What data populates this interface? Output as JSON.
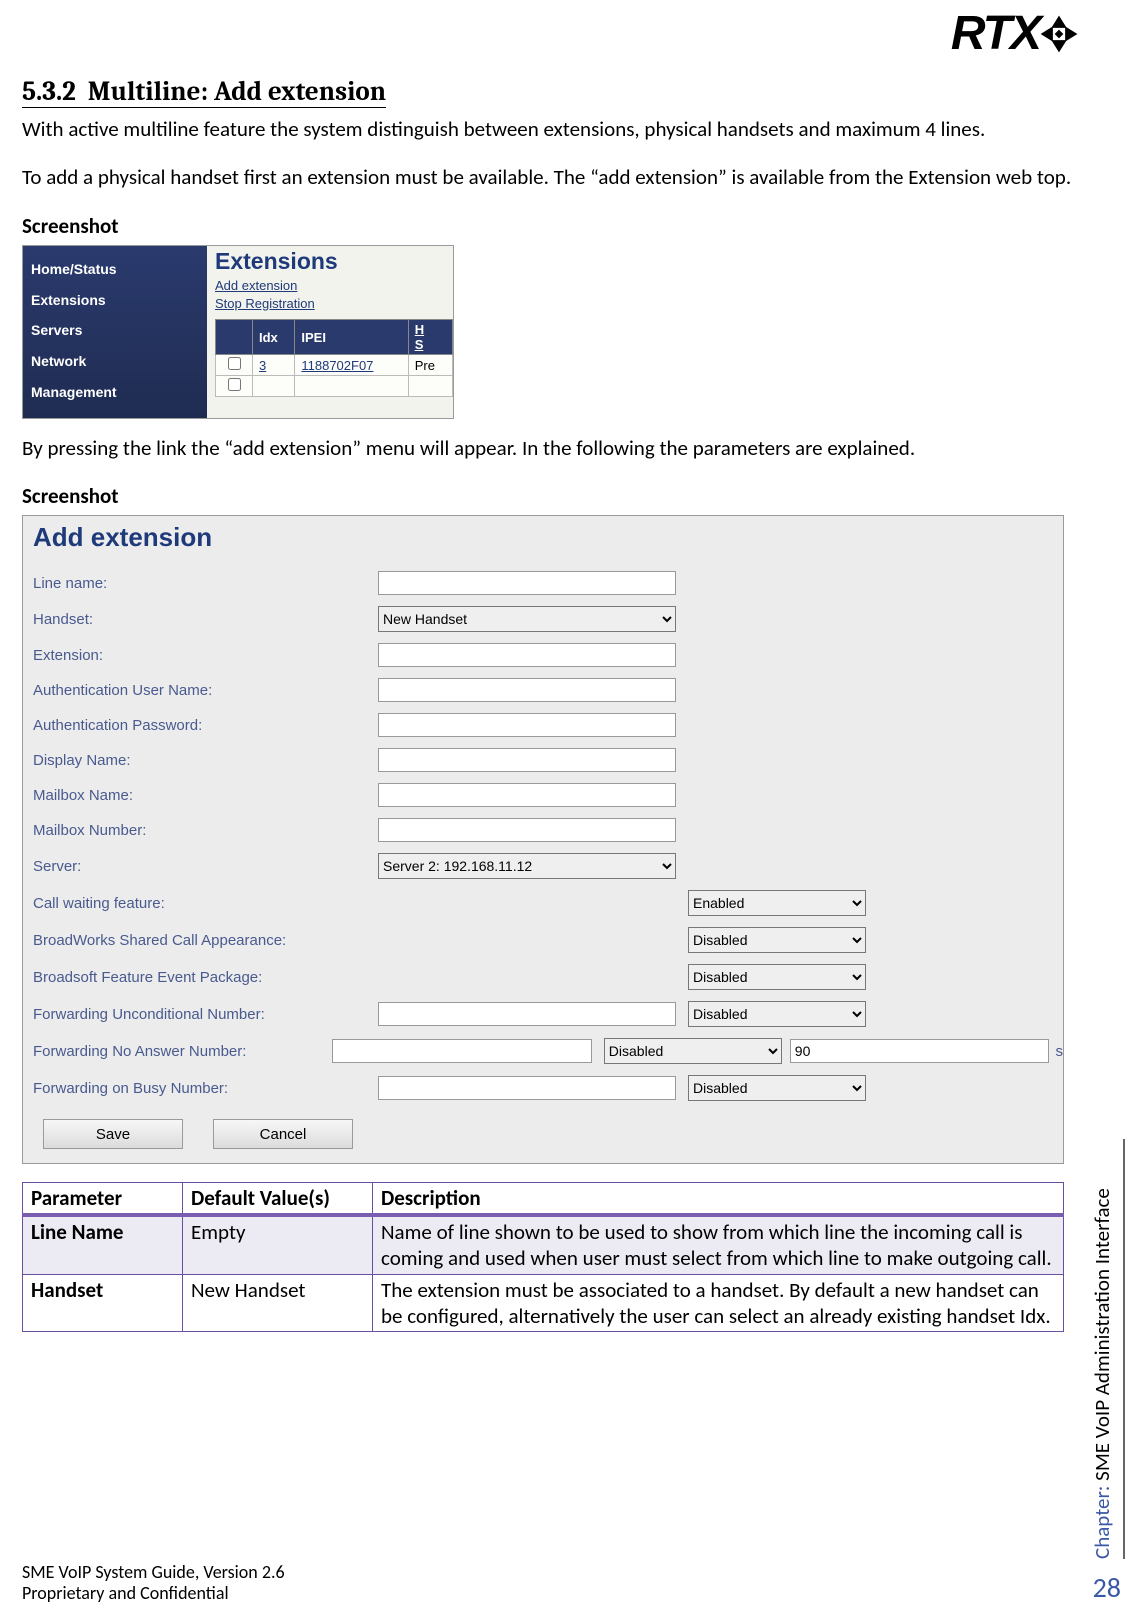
{
  "logo_text": "RTX",
  "section_number": "5.3.2",
  "section_title": "Multiline: Add extension",
  "para1": "With active multiline feature the system distinguish between extensions, physical handsets and maximum 4 lines.",
  "para2": "To add a physical handset first an extension must be available. The “add extension” is available from the Extension web top.",
  "screenshot_label": "Screenshot",
  "ss1": {
    "nav": [
      "Home/Status",
      "Extensions",
      "Servers",
      "Network",
      "Management"
    ],
    "title": "Extensions",
    "links": [
      "Add extension",
      "Stop Registration"
    ],
    "cols": [
      "",
      "Idx",
      "IPEI",
      "H\nS"
    ],
    "row": {
      "idx": "3",
      "ipei": "1188702F07",
      "state": "Pre"
    }
  },
  "para3": "By pressing the link the “add extension” menu will appear. In the following the parameters are explained.",
  "ss2": {
    "title": "Add extension",
    "labels": {
      "line_name": "Line name:",
      "handset": "Handset:",
      "extension": "Extension:",
      "auth_user": "Authentication User Name:",
      "auth_pass": "Authentication Password:",
      "display_name": "Display Name:",
      "mailbox_name": "Mailbox Name:",
      "mailbox_number": "Mailbox Number:",
      "server": "Server:",
      "call_waiting": "Call waiting feature:",
      "bw_sca": "BroadWorks Shared Call Appearance:",
      "bs_fep": "Broadsoft Feature Event Package:",
      "fwd_uncond": "Forwarding Unconditional Number:",
      "fwd_noanswer": "Forwarding No Answer Number:",
      "fwd_busy": "Forwarding on Busy Number:"
    },
    "values": {
      "handset": "New Handset",
      "server": "Server 2: 192.168.11.12",
      "enabled": "Enabled",
      "disabled": "Disabled",
      "noanswer_sec": "90",
      "sec_suffix": "s"
    },
    "buttons": {
      "save": "Save",
      "cancel": "Cancel"
    }
  },
  "table": {
    "headers": [
      "Parameter",
      "Default Value(s)",
      "Description"
    ],
    "rows": [
      {
        "param": "Line Name",
        "default": "Empty",
        "desc": "Name of line shown to be used to show from which line the incoming call is coming and used when user must select from which line to make outgoing call."
      },
      {
        "param": "Handset",
        "default": "New Handset",
        "desc": "The extension must be associated to a handset. By default a new handset can be configured, alternatively the user can select an already existing handset Idx."
      }
    ]
  },
  "side": {
    "chapter_prefix": "Chapter:",
    "chapter_title": " SME VoIP Administration Interface"
  },
  "footer": {
    "l1": "SME VoIP System Guide, Version 2.6",
    "l2": "Proprietary and Confidential"
  },
  "page_number": "28"
}
